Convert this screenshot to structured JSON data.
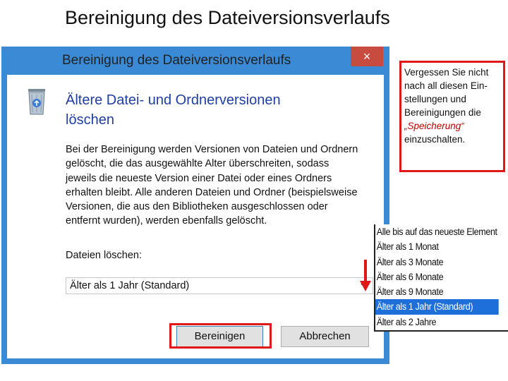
{
  "slide": {
    "title": "Bereinigung des Dateiversionsverlaufs"
  },
  "dialog": {
    "title": "Bereinigung des Dateiversionsverlaufs",
    "close_label": "×",
    "heading_line1": "Ältere Datei- und Ordnerversionen",
    "heading_line2": "löschen",
    "description": "Bei der Bereinigung werden Versionen von Dateien und Ordnern gelöscht, die das ausgewählte Alter überschreiten, sodass jeweils die neueste Version einer Datei oder eines Ordners erhalten bleibt. Alle anderen Dateien und Ordner (beispielsweise Versionen, die aus den Bibliotheken ausgeschlossen oder entfernt wurden), werden ebenfalls gelöscht.",
    "delete_label": "Dateien löschen:",
    "selected_option": "Älter als 1 Jahr (Standard)",
    "cleanup_button": "Bereinigen",
    "cancel_button": "Abbrechen"
  },
  "dropdown": {
    "options": [
      "Alle bis auf das neueste Element",
      "Älter als 1 Monat",
      "Älter als 3 Monate",
      "Älter als 6 Monate",
      "Älter als 9 Monate",
      "Älter als 1 Jahr (Standard)",
      "Älter als 2 Jahre"
    ],
    "selected_index": 5
  },
  "note": {
    "text_before": "Vergessen Sie nicht nach all diesen Ein-stellungen und Bereinigungen die",
    "emphasis": "„Speicherung“",
    "text_after": "einzuschalten."
  },
  "colors": {
    "accent": "#3a8ad6",
    "highlight": "#e01818",
    "selection": "#1e6fd9",
    "close": "#c74b3f"
  },
  "icons": {
    "app": "recycle-bin-icon",
    "dropdown": "chevron-down-icon",
    "pointer": "red-arrow-icon"
  }
}
